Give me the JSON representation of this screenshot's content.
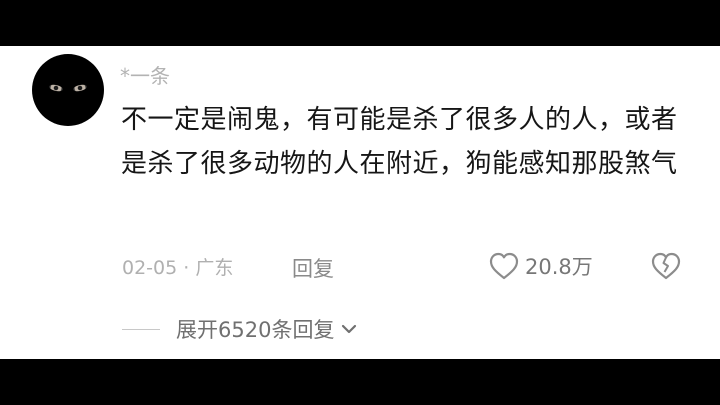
{
  "comment": {
    "username": "*一条",
    "text": "不一定是闹鬼，有可能是杀了很多人的人，或者是杀了很多动物的人在附近，狗能感知那股煞气",
    "date_location": "02-05 · 广东",
    "reply_label": "回复",
    "like_count": "20.8万",
    "expand_label": "展开6520条回复",
    "icons": {
      "avatar": "avatar-eyes-icon",
      "like": "heart-outline-icon",
      "dislike": "broken-heart-icon",
      "expand": "chevron-down-icon"
    }
  }
}
